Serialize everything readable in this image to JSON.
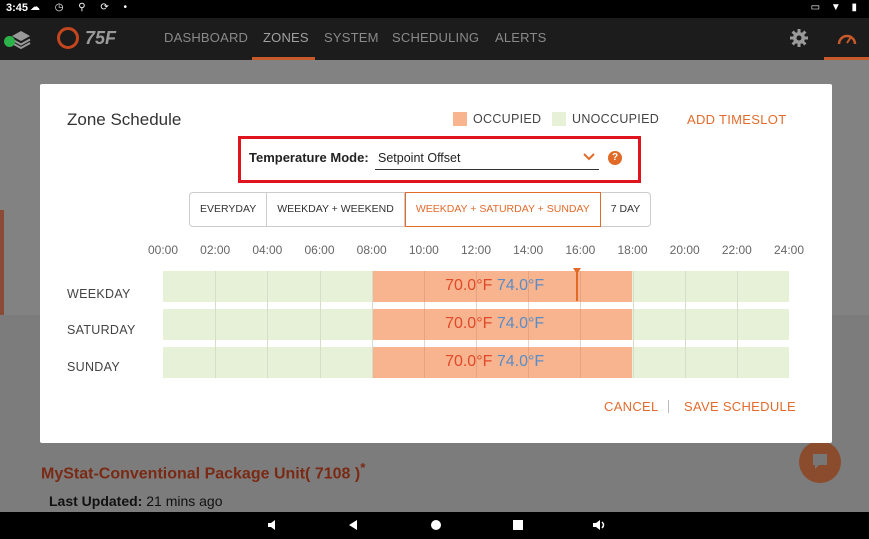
{
  "status_bar": {
    "time": "3:45",
    "left_icons": [
      "cloud-icon",
      "clock-icon",
      "usb-icon",
      "sync-icon",
      "dot-icon"
    ],
    "right_icons": [
      "cast-icon",
      "wifi-icon",
      "battery-icon"
    ]
  },
  "nav": {
    "logo_text": "75F",
    "tabs": [
      {
        "label": "DASHBOARD",
        "active": false
      },
      {
        "label": "ZONES",
        "active": true
      },
      {
        "label": "SYSTEM",
        "active": false
      },
      {
        "label": "SCHEDULING",
        "active": false
      },
      {
        "label": "ALERTS",
        "active": false
      }
    ],
    "accent_color": "#c65a2a"
  },
  "background": {
    "zone_title": "MyStat-Conventional Package Unit( 7108 )",
    "title_suffix": "*",
    "last_updated_label": "Last Updated:",
    "last_updated_value": "21 mins ago"
  },
  "modal": {
    "title": "Zone Schedule",
    "legend": [
      {
        "label": "OCCUPIED",
        "color": "#f7b48e"
      },
      {
        "label": "UNOCCUPIED",
        "color": "#e6f1d8"
      }
    ],
    "add_timeslot": "ADD TIMESLOT",
    "temperature_mode_label": "Temperature Mode:",
    "temperature_mode_value": "Setpoint Offset",
    "help_icon": "?",
    "schedule_types": [
      {
        "label": "EVERYDAY",
        "active": false
      },
      {
        "label": "WEEKDAY + WEEKEND",
        "active": false
      },
      {
        "label": "WEEKDAY + SATURDAY + SUNDAY",
        "active": true
      },
      {
        "label": "7 DAY",
        "active": false
      }
    ],
    "hours": [
      "00:00",
      "02:00",
      "04:00",
      "06:00",
      "08:00",
      "10:00",
      "12:00",
      "14:00",
      "16:00",
      "18:00",
      "20:00",
      "22:00",
      "24:00"
    ],
    "rows": [
      {
        "day": "WEEKDAY",
        "occupied_start": "08:00",
        "occupied_end": "18:00",
        "heating": "70.0°F",
        "cooling": "74.0°F"
      },
      {
        "day": "SATURDAY",
        "occupied_start": "08:00",
        "occupied_end": "18:00",
        "heating": "70.0°F",
        "cooling": "74.0°F"
      },
      {
        "day": "SUNDAY",
        "occupied_start": "08:00",
        "occupied_end": "18:00",
        "heating": "70.0°F",
        "cooling": "74.0°F"
      }
    ],
    "cancel": "CANCEL",
    "save": "SAVE SCHEDULE"
  }
}
